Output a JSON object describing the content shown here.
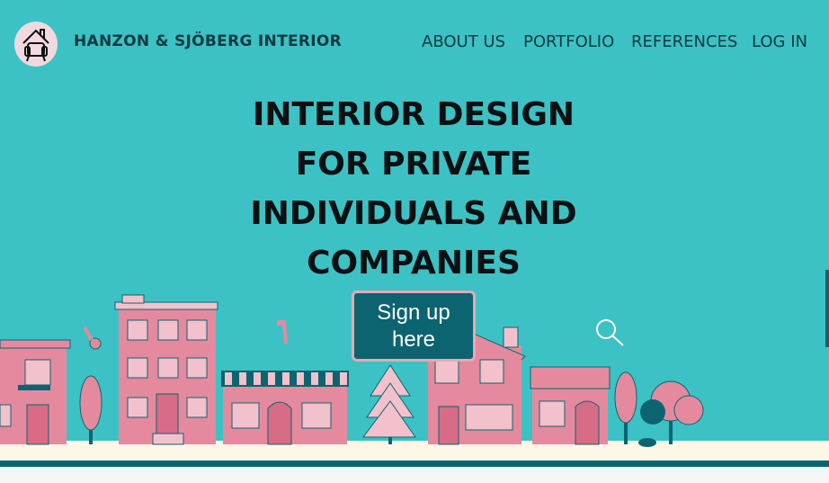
{
  "brand": {
    "name": "HANZON & SJÖBERG INTERIOR",
    "logo_icon": "armchair-house-icon"
  },
  "nav": {
    "items": [
      {
        "label": "ABOUT US"
      },
      {
        "label": "PORTFOLIO"
      },
      {
        "label": "REFERENCES"
      },
      {
        "label": "LOG IN"
      }
    ]
  },
  "hero": {
    "lines": [
      "INTERIOR DESIGN",
      "FOR PRIVATE",
      "INDIVIDUALS AND",
      "COMPANIES"
    ]
  },
  "cta": {
    "label": "Sign up here"
  },
  "colors": {
    "background": "#3cc2c4",
    "text_dark": "#0c1012",
    "nav_text": "#0e3a40",
    "button_bg": "#0b6470",
    "button_border": "#e6a9b4",
    "house_pink": "#e58a9e",
    "house_dark": "#0b6470",
    "ground": "#fdf7e8"
  },
  "illustration": {
    "icons": [
      "key-icon",
      "hammer-icon",
      "magnifier-icon"
    ]
  }
}
